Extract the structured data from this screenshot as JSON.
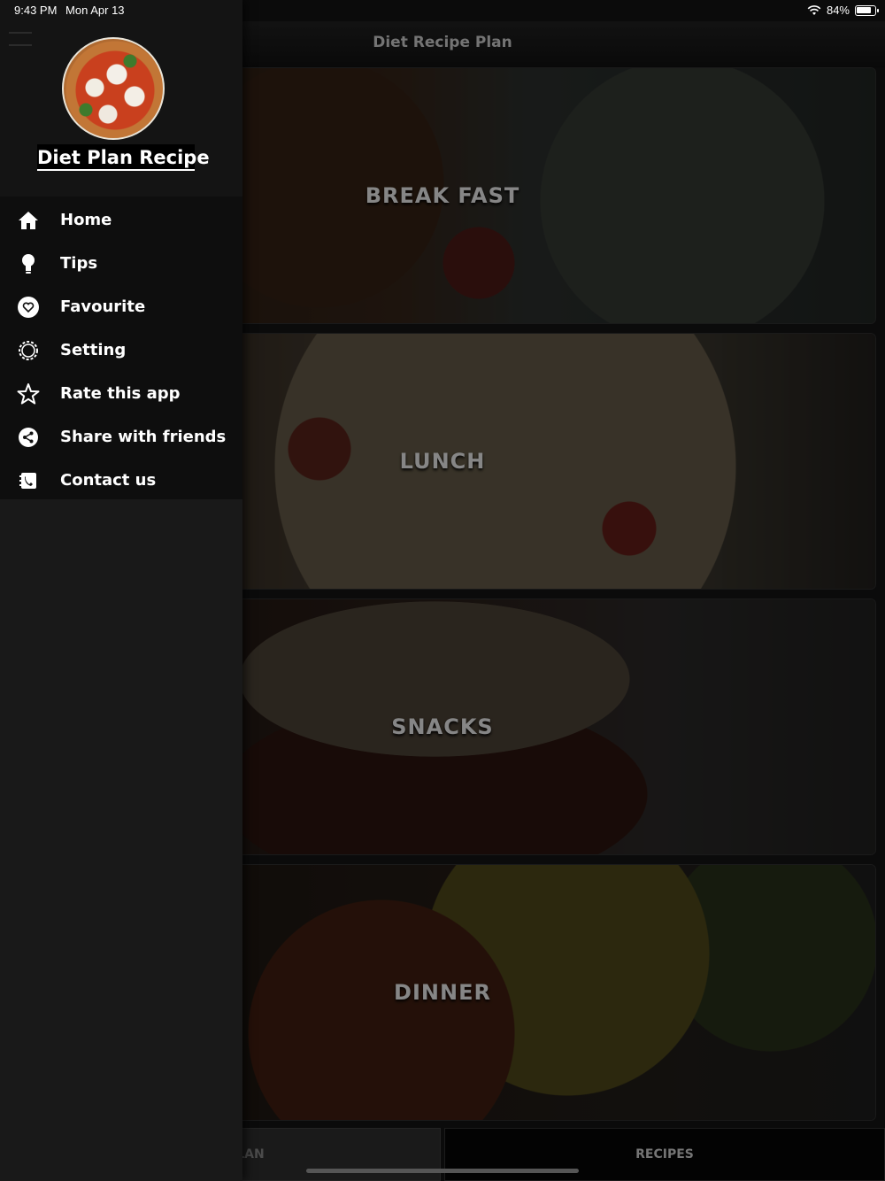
{
  "status_bar": {
    "time": "9:43 PM",
    "date": "Mon Apr 13",
    "battery": "84%",
    "battery_level": 0.84
  },
  "header": {
    "title": "Diet Recipe Plan"
  },
  "cards": [
    {
      "label": "BREAK FAST"
    },
    {
      "label": "LUNCH"
    },
    {
      "label": "SNACKS"
    },
    {
      "label": "DINNER"
    }
  ],
  "tabs": {
    "today_plan": "TODAY PLAN",
    "recipes": "RECIPES"
  },
  "drawer": {
    "app_name": "Diet Plan Recipe",
    "items": [
      {
        "label": "Home",
        "icon": "home-icon"
      },
      {
        "label": "Tips",
        "icon": "lightbulb-icon"
      },
      {
        "label": "Favourite",
        "icon": "heart-icon"
      },
      {
        "label": "Setting",
        "icon": "gear-icon"
      },
      {
        "label": "Rate this app",
        "icon": "star-icon"
      },
      {
        "label": "Share with friends",
        "icon": "share-icon"
      },
      {
        "label": "Contact us",
        "icon": "phone-book-icon"
      }
    ]
  }
}
